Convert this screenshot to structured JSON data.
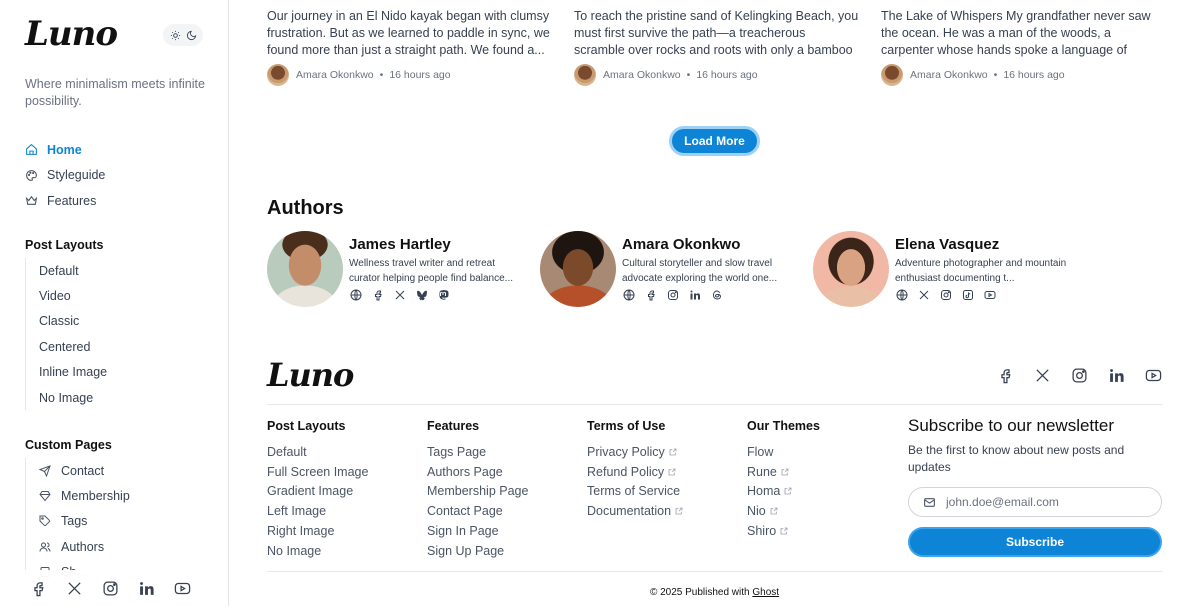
{
  "sidebar": {
    "logo": "Luno",
    "tagline": "Where minimalism meets infinite possibility.",
    "nav": [
      {
        "label": "Home",
        "icon": "home-icon"
      },
      {
        "label": "Styleguide",
        "icon": "palette-icon"
      },
      {
        "label": "Features",
        "icon": "crown-icon"
      }
    ],
    "post_layouts_title": "Post Layouts",
    "post_layouts": [
      "Default",
      "Video",
      "Classic",
      "Centered",
      "Inline Image",
      "No Image"
    ],
    "custom_pages_title": "Custom Pages",
    "custom_pages": [
      {
        "label": "Contact",
        "icon": "send-icon"
      },
      {
        "label": "Membership",
        "icon": "diamond-icon"
      },
      {
        "label": "Tags",
        "icon": "tag-icon"
      },
      {
        "label": "Authors",
        "icon": "users-icon"
      },
      {
        "label": "Sh...",
        "icon": "page-icon"
      }
    ]
  },
  "posts": [
    {
      "excerpt": "Our journey in an El Nido kayak began with clumsy frustration. But as we learned to paddle in sync, we found more than just a straight path. We found a...",
      "author": "Amara Okonkwo",
      "time": "16 hours ago"
    },
    {
      "excerpt": "To reach the pristine sand of Kelingking Beach, you must first survive the path—a treacherous scramble over rocks and roots with only a bamboo rail betwe...",
      "author": "Amara Okonkwo",
      "time": "16 hours ago"
    },
    {
      "excerpt": "The Lake of Whispers My grandfather never saw the ocean. He was a man of the woods, a carpenter whose hands spoke a language of patience and...",
      "author": "Amara Okonkwo",
      "time": "16 hours ago"
    }
  ],
  "load_more": "Load More",
  "authors_title": "Authors",
  "authors": [
    {
      "name": "James Hartley",
      "bio": "Wellness travel writer and retreat curator helping people find balance...",
      "links": [
        "globe-icon",
        "facebook-icon",
        "x-icon",
        "bluesky-icon",
        "mastodon-icon"
      ]
    },
    {
      "name": "Amara Okonkwo",
      "bio": "Cultural storyteller and slow travel advocate exploring the world one...",
      "links": [
        "globe-icon",
        "facebook-icon",
        "instagram-icon",
        "linkedin-icon",
        "threads-icon"
      ]
    },
    {
      "name": "Elena Vasquez",
      "bio": "Adventure photographer and mountain enthusiast documenting t...",
      "links": [
        "globe-icon",
        "x-icon",
        "instagram-icon",
        "tiktok-icon",
        "youtube-icon"
      ]
    }
  ],
  "footer": {
    "logo": "Luno",
    "columns": [
      {
        "title": "Post Layouts",
        "links": [
          {
            "label": "Default",
            "external": false
          },
          {
            "label": "Full Screen Image",
            "external": false
          },
          {
            "label": "Gradient Image",
            "external": false
          },
          {
            "label": "Left Image",
            "external": false
          },
          {
            "label": "Right Image",
            "external": false
          },
          {
            "label": "No Image",
            "external": false
          }
        ]
      },
      {
        "title": "Features",
        "links": [
          {
            "label": "Tags Page",
            "external": false
          },
          {
            "label": "Authors Page",
            "external": false
          },
          {
            "label": "Membership Page",
            "external": false
          },
          {
            "label": "Contact Page",
            "external": false
          },
          {
            "label": "Sign In Page",
            "external": false
          },
          {
            "label": "Sign Up Page",
            "external": false
          }
        ]
      },
      {
        "title": "Terms of Use",
        "links": [
          {
            "label": "Privacy Policy",
            "external": true
          },
          {
            "label": "Refund Policy",
            "external": true
          },
          {
            "label": "Terms of Service",
            "external": false
          },
          {
            "label": "Documentation",
            "external": true
          }
        ]
      },
      {
        "title": "Our Themes",
        "links": [
          {
            "label": "Flow",
            "external": false
          },
          {
            "label": "Rune",
            "external": true
          },
          {
            "label": "Homa",
            "external": true
          },
          {
            "label": "Nio",
            "external": true
          },
          {
            "label": "Shiro",
            "external": true
          }
        ]
      }
    ],
    "newsletter": {
      "title": "Subscribe to our newsletter",
      "description": "Be the first to know about new posts and updates",
      "email_placeholder": "john.doe@email.com",
      "button": "Subscribe"
    },
    "copyright_prefix": "© 2025 Published with ",
    "copyright_link": "Ghost"
  },
  "colors": {
    "accent": "#0e84d6",
    "text": "#1f2937",
    "muted": "#6b7280",
    "border": "#e5e7eb"
  }
}
